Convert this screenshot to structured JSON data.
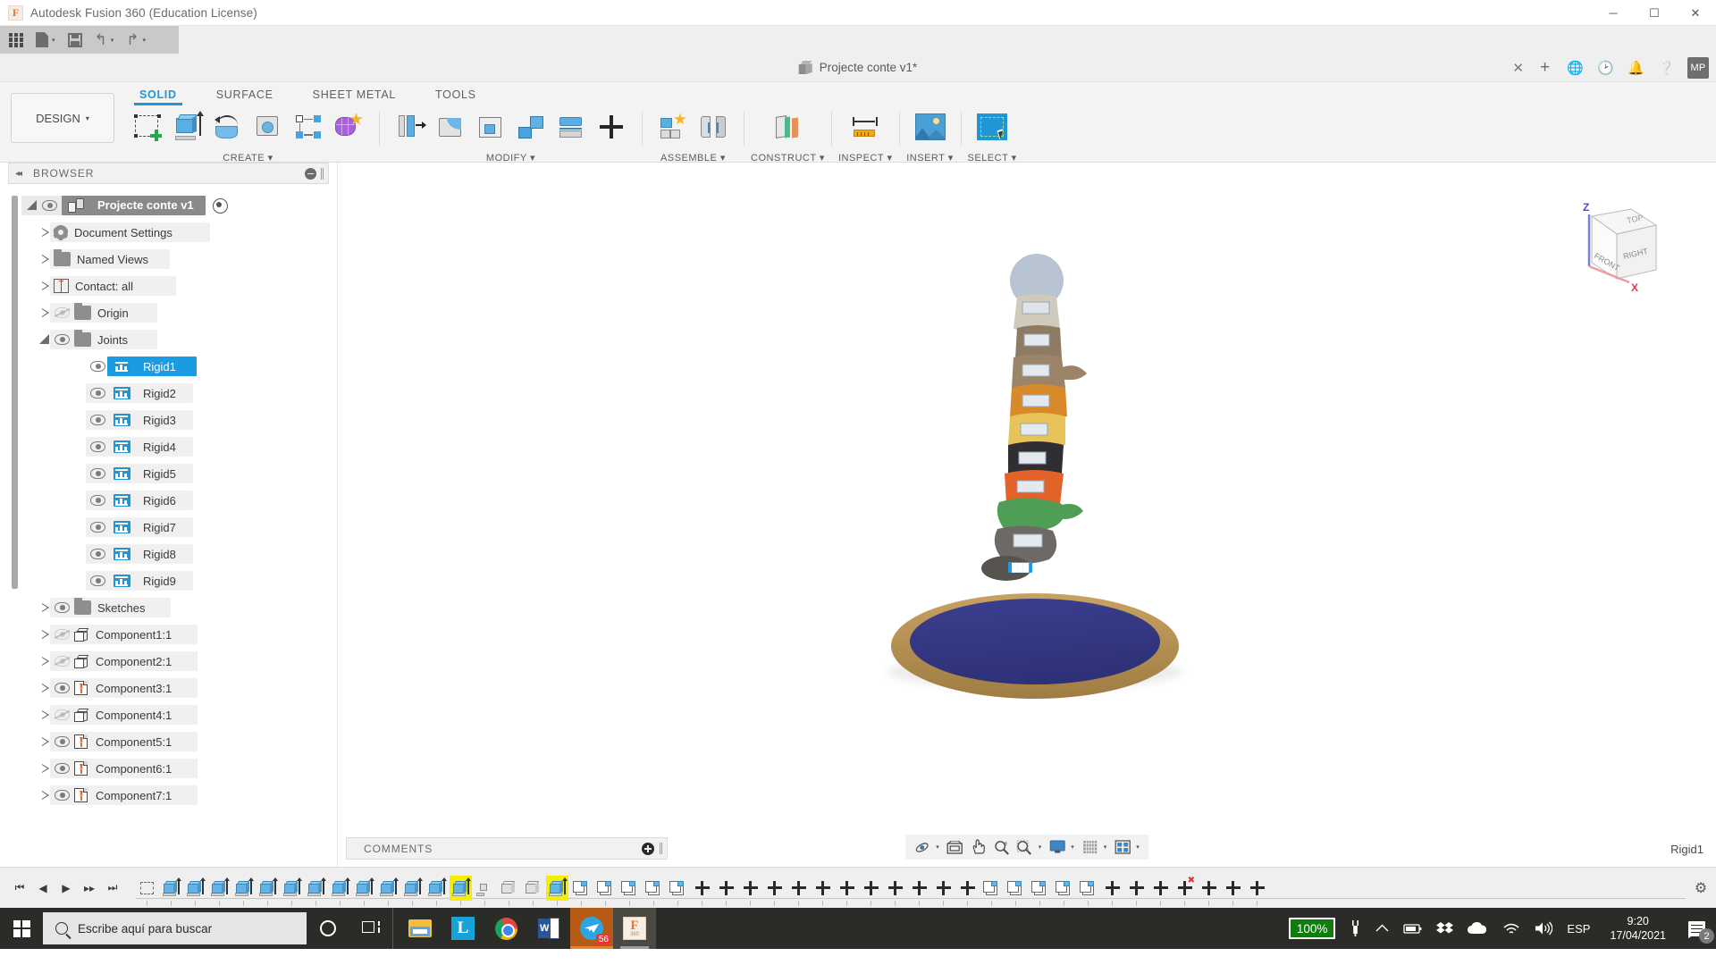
{
  "window": {
    "app_title": "Autodesk Fusion 360 (Education License)",
    "logo_letter": "F",
    "minimize": "─",
    "maximize": "☐",
    "close": "✕"
  },
  "quick_access": {
    "grid_label": "app-grid",
    "new_label": "new-document",
    "save_label": "save",
    "undo_label": "undo",
    "redo_label": "redo",
    "caret": "▾"
  },
  "document_tab": {
    "title": "Projecte conte v1*",
    "close": "✕",
    "add": "+",
    "avatar": "MP",
    "icons": [
      "globe-icon",
      "clock-icon",
      "bell-icon",
      "help-icon"
    ]
  },
  "ribbon": {
    "design_label": "DESIGN",
    "design_caret": "▾",
    "tabs": [
      {
        "label": "SOLID",
        "active": true
      },
      {
        "label": "SURFACE",
        "active": false
      },
      {
        "label": "SHEET METAL",
        "active": false
      },
      {
        "label": "TOOLS",
        "active": false
      }
    ],
    "panels": [
      {
        "label": "CREATE ▾",
        "name": "create-panel"
      },
      {
        "label": "MODIFY ▾",
        "name": "modify-panel"
      },
      {
        "label": "ASSEMBLE ▾",
        "name": "assemble-panel"
      },
      {
        "label": "CONSTRUCT ▾",
        "name": "construct-panel"
      },
      {
        "label": "INSPECT ▾",
        "name": "inspect-panel"
      },
      {
        "label": "INSERT ▾",
        "name": "insert-panel"
      },
      {
        "label": "SELECT ▾",
        "name": "select-panel"
      }
    ]
  },
  "browser": {
    "header": "BROWSER",
    "collapse": "◂◂",
    "root": "Projecte conte v1",
    "items": [
      {
        "label": "Document Settings",
        "icon": "gear-icon",
        "indent": 1,
        "expandable": true,
        "eye": "none",
        "selected": false
      },
      {
        "label": "Named Views",
        "icon": "folder-icon",
        "indent": 1,
        "expandable": true,
        "eye": "none",
        "selected": false
      },
      {
        "label": "Contact: all",
        "icon": "contact-icon",
        "indent": 1,
        "expandable": true,
        "eye": "none",
        "selected": false
      },
      {
        "label": "Origin",
        "icon": "folder-icon",
        "indent": 1,
        "expandable": true,
        "eye": "hidden",
        "selected": false
      },
      {
        "label": "Joints",
        "icon": "folder-icon",
        "indent": 1,
        "expandable": "open",
        "eye": "visible",
        "selected": false
      },
      {
        "label": "Rigid1",
        "icon": "joint-icon",
        "indent": 2,
        "expandable": false,
        "eye": "visible",
        "selected": true
      },
      {
        "label": "Rigid2",
        "icon": "joint-icon",
        "indent": 2,
        "expandable": false,
        "eye": "visible",
        "selected": false
      },
      {
        "label": "Rigid3",
        "icon": "joint-icon",
        "indent": 2,
        "expandable": false,
        "eye": "visible",
        "selected": false
      },
      {
        "label": "Rigid4",
        "icon": "joint-icon",
        "indent": 2,
        "expandable": false,
        "eye": "visible",
        "selected": false
      },
      {
        "label": "Rigid5",
        "icon": "joint-icon",
        "indent": 2,
        "expandable": false,
        "eye": "visible",
        "selected": false
      },
      {
        "label": "Rigid6",
        "icon": "joint-icon",
        "indent": 2,
        "expandable": false,
        "eye": "visible",
        "selected": false
      },
      {
        "label": "Rigid7",
        "icon": "joint-icon",
        "indent": 2,
        "expandable": false,
        "eye": "visible",
        "selected": false
      },
      {
        "label": "Rigid8",
        "icon": "joint-icon",
        "indent": 2,
        "expandable": false,
        "eye": "visible",
        "selected": false
      },
      {
        "label": "Rigid9",
        "icon": "joint-icon",
        "indent": 2,
        "expandable": false,
        "eye": "visible",
        "selected": false
      },
      {
        "label": "Sketches",
        "icon": "folder-icon",
        "indent": 1,
        "expandable": true,
        "eye": "visible",
        "selected": false
      },
      {
        "label": "Component1:1",
        "icon": "component-icon",
        "indent": 1,
        "expandable": true,
        "eye": "hidden",
        "selected": false
      },
      {
        "label": "Component2:1",
        "icon": "component-icon",
        "indent": 1,
        "expandable": true,
        "eye": "hidden",
        "selected": false
      },
      {
        "label": "Component3:1",
        "icon": "grounded-icon",
        "indent": 1,
        "expandable": true,
        "eye": "visible",
        "selected": false
      },
      {
        "label": "Component4:1",
        "icon": "component-icon",
        "indent": 1,
        "expandable": true,
        "eye": "hidden",
        "selected": false
      },
      {
        "label": "Component5:1",
        "icon": "grounded-icon",
        "indent": 1,
        "expandable": true,
        "eye": "visible",
        "selected": false
      },
      {
        "label": "Component6:1",
        "icon": "grounded-icon",
        "indent": 1,
        "expandable": true,
        "eye": "visible",
        "selected": false
      },
      {
        "label": "Component7:1",
        "icon": "grounded-icon",
        "indent": 1,
        "expandable": true,
        "eye": "visible",
        "selected": false
      }
    ]
  },
  "comments": {
    "label": "COMMENTS",
    "add": "+"
  },
  "viewcube": {
    "top": "TOP",
    "front": "FRONT",
    "right": "RIGHT",
    "axis_z": "Z",
    "axis_x": "X"
  },
  "navbar": {
    "items": [
      {
        "name": "orbit-icon",
        "caret": true
      },
      {
        "name": "look-at-icon",
        "caret": false
      },
      {
        "name": "pan-icon",
        "caret": false
      },
      {
        "name": "zoom-icon",
        "caret": false
      },
      {
        "name": "fit-icon",
        "caret": true
      },
      {
        "name": "display-settings-icon",
        "caret": true
      },
      {
        "name": "grid-snap-icon",
        "caret": true
      },
      {
        "name": "viewports-icon",
        "caret": true
      }
    ]
  },
  "status": {
    "selection": "Rigid1"
  },
  "timeline": {
    "playback": [
      "⏮",
      "◀",
      "▶",
      "▸▸",
      "⏭"
    ],
    "settings": "⚙",
    "features": [
      {
        "type": "sketch",
        "highlight": false
      },
      {
        "type": "extrude",
        "highlight": false
      },
      {
        "type": "extrude",
        "highlight": false
      },
      {
        "type": "extrude",
        "highlight": false
      },
      {
        "type": "extrude",
        "highlight": false
      },
      {
        "type": "extrude",
        "highlight": false
      },
      {
        "type": "extrude",
        "highlight": false
      },
      {
        "type": "extrude",
        "highlight": false
      },
      {
        "type": "extrude",
        "highlight": false
      },
      {
        "type": "extrude",
        "highlight": false
      },
      {
        "type": "extrude",
        "highlight": false
      },
      {
        "type": "extrude",
        "highlight": false
      },
      {
        "type": "extrude",
        "highlight": false
      },
      {
        "type": "extrude",
        "highlight": true
      },
      {
        "type": "move",
        "highlight": false
      },
      {
        "type": "body",
        "highlight": false
      },
      {
        "type": "body",
        "highlight": false
      },
      {
        "type": "extrude",
        "highlight": true
      },
      {
        "type": "asm",
        "highlight": false
      },
      {
        "type": "asm",
        "highlight": false
      },
      {
        "type": "asm",
        "highlight": false
      },
      {
        "type": "asm",
        "highlight": false
      },
      {
        "type": "asm",
        "highlight": false
      },
      {
        "type": "joint",
        "highlight": false
      },
      {
        "type": "joint",
        "highlight": false
      },
      {
        "type": "joint",
        "highlight": false
      },
      {
        "type": "joint",
        "highlight": false
      },
      {
        "type": "joint",
        "highlight": false
      },
      {
        "type": "joint",
        "highlight": false
      },
      {
        "type": "joint",
        "highlight": false
      },
      {
        "type": "joint",
        "highlight": false
      },
      {
        "type": "joint",
        "highlight": false
      },
      {
        "type": "joint",
        "highlight": false
      },
      {
        "type": "joint",
        "highlight": false
      },
      {
        "type": "joint",
        "highlight": false
      },
      {
        "type": "asm",
        "highlight": false
      },
      {
        "type": "asm",
        "highlight": false
      },
      {
        "type": "asm",
        "highlight": false
      },
      {
        "type": "asm",
        "highlight": false
      },
      {
        "type": "asm",
        "highlight": false
      },
      {
        "type": "joint",
        "highlight": false
      },
      {
        "type": "joint",
        "highlight": false
      },
      {
        "type": "joint",
        "highlight": false
      },
      {
        "type": "joint-del",
        "highlight": false
      },
      {
        "type": "joint",
        "highlight": false
      },
      {
        "type": "joint",
        "highlight": false
      },
      {
        "type": "joint",
        "highlight": false
      }
    ]
  },
  "taskbar": {
    "search_placeholder": "Escribe aquí para buscar",
    "apps": [
      {
        "name": "task-view",
        "label": ""
      },
      {
        "name": "file-explorer",
        "label": ""
      },
      {
        "name": "libreoffice",
        "label": "L"
      },
      {
        "name": "chrome",
        "label": ""
      },
      {
        "name": "word",
        "label": "W"
      },
      {
        "name": "telegram",
        "label": "",
        "badge": "56"
      },
      {
        "name": "fusion360",
        "label": "F",
        "sublabel": "360"
      }
    ],
    "tray": {
      "battery_percent": "100%",
      "language": "ESP",
      "time": "9:20",
      "date": "17/04/2021",
      "notification_count": "2",
      "icons": [
        "plug-icon",
        "chevron-up-icon",
        "battery-icon",
        "dropbox-icon",
        "onedrive-icon",
        "wifi-icon",
        "volume-icon"
      ]
    }
  },
  "colors": {
    "accent": "#2196d6",
    "selection": "#1b9ce2",
    "timeline_highlight": "#f2f000",
    "battery_green": "#107c10",
    "taskbar_bg": "#2b2b28"
  }
}
